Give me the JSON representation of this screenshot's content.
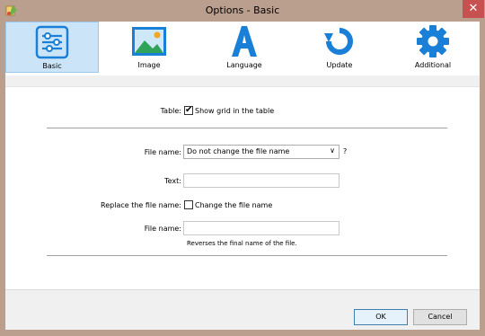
{
  "window": {
    "title": "Options - Basic",
    "close": "✕"
  },
  "toolbar": {
    "items": [
      {
        "label": "Basic",
        "icon": "sliders-icon"
      },
      {
        "label": "Image",
        "icon": "image-icon"
      },
      {
        "label": "Language",
        "icon": "language-icon"
      },
      {
        "label": "Update",
        "icon": "refresh-icon"
      },
      {
        "label": "Additional",
        "icon": "gear-icon"
      }
    ],
    "selected": "Basic",
    "accent_color": "#1a7fd6"
  },
  "form": {
    "table_label": "Table:",
    "show_grid_label": "Show grid in the table",
    "show_grid_checked": true,
    "file_name_label": "File name:",
    "file_name_select_value": "Do not change the file name",
    "help_mark": "?",
    "text_label": "Text:",
    "text_value": "",
    "replace_label": "Replace the file name:",
    "change_name_label": "Change the file name",
    "change_name_checked": false,
    "file_name2_label": "File name:",
    "file_name2_value": "",
    "reverse_hint": "Reverses the final name of the file."
  },
  "buttons": {
    "ok": "OK",
    "cancel": "Cancel"
  }
}
